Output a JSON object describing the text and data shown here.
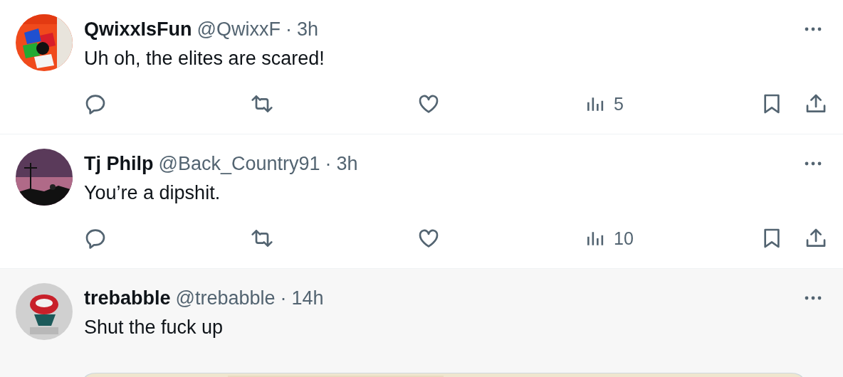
{
  "replies": [
    {
      "display_name": "QwixxIsFun",
      "handle": "@QwixxF",
      "time": "3h",
      "separator": "·",
      "text": "Uh oh, the elites are scared!",
      "highlighted": false,
      "actions": {
        "views": "5"
      }
    },
    {
      "display_name": "Tj Philp",
      "handle": "@Back_Country91",
      "time": "3h",
      "separator": "·",
      "text": "You’re a dipshit.",
      "highlighted": false,
      "actions": {
        "views": "10"
      }
    },
    {
      "display_name": "trebabble",
      "handle": "@trebabble",
      "time": "14h",
      "separator": "·",
      "text": "Shut the fuck up",
      "highlighted": true
    }
  ]
}
